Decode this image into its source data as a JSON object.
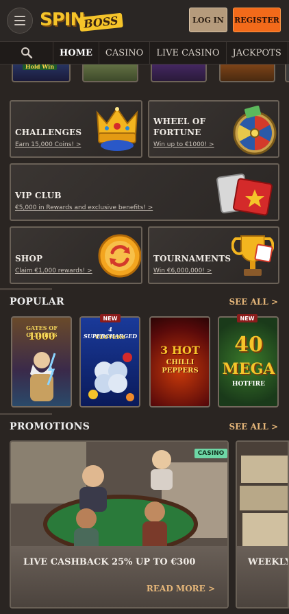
{
  "header": {
    "logo_spin": "SPIN",
    "logo_boss": "BOSS",
    "login_label": "LOG IN",
    "register_label": "REGISTER"
  },
  "nav": {
    "tabs": [
      "HOME",
      "CASINO",
      "LIVE CASINO",
      "JACKPOTS"
    ],
    "active": "HOME"
  },
  "top_strip": {
    "visible_text": "Hold Win"
  },
  "tiles": {
    "challenges": {
      "title": "CHALLENGES",
      "subtitle": "Earn 15,000 Coins! >"
    },
    "wheel": {
      "title_line1": "WHEEL OF",
      "title_line2": "FORTUNE",
      "subtitle": "Win up to €1000! >"
    },
    "vip": {
      "title": "VIP CLUB",
      "subtitle": "€5,000 in Rewards and exclusive benefits! >"
    },
    "shop": {
      "title": "SHOP",
      "subtitle": "Claim €1,000 rewards! >"
    },
    "tournaments": {
      "title": "TOURNAMENTS",
      "subtitle": "Win €6,000,000! >"
    }
  },
  "popular": {
    "title": "POPULAR",
    "see_all": "SEE ALL >",
    "games": [
      {
        "name_line1": "GATES OF OLYMPUS",
        "name_line2": "1000",
        "badge": ""
      },
      {
        "name_line1": "4 SUPERCHARGED",
        "name_line2": "CLOVERS",
        "badge": "NEW"
      },
      {
        "name_line1": "3 HOT",
        "name_line2": "CHILLI PEPPERS",
        "badge": ""
      },
      {
        "name_line1": "40",
        "name_line2": "MEGA",
        "name_line3": "HOTFIRE",
        "badge": "NEW"
      }
    ]
  },
  "promotions": {
    "title": "PROMOTIONS",
    "see_all": "SEE ALL >",
    "cards": [
      {
        "tag": "CASINO",
        "title": "LIVE CASHBACK 25% UP TO €300",
        "cta": "READ MORE >"
      },
      {
        "title": "WEEKLY"
      }
    ]
  },
  "colors": {
    "accent_orange": "#f26a1a",
    "gold": "#e6b77a",
    "new_badge": "#8c1c1c",
    "casino_tag": "#6ed7a6"
  }
}
